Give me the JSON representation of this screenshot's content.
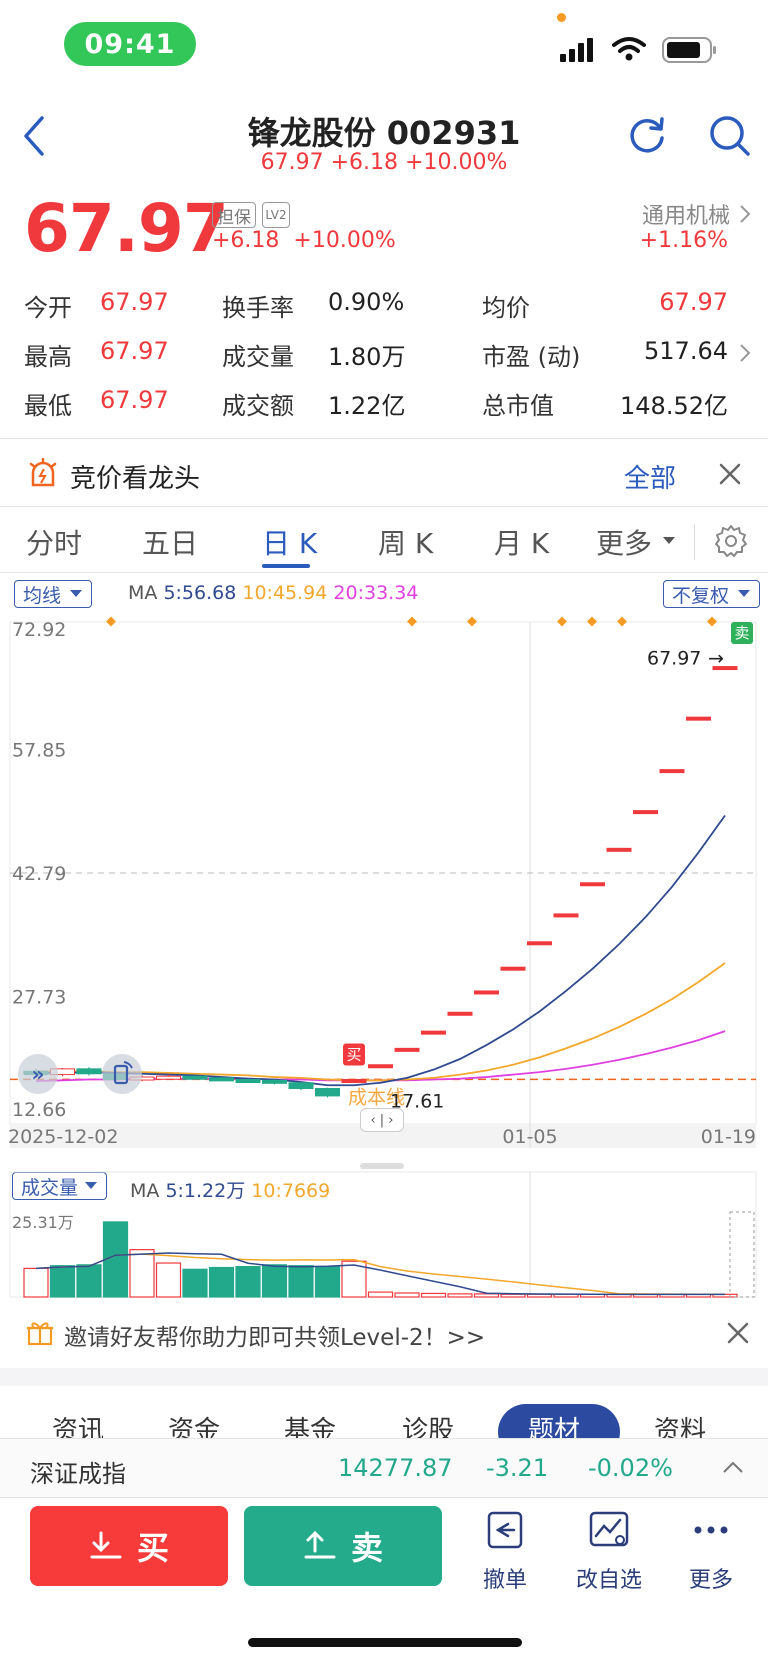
{
  "status": {
    "time": "09:41"
  },
  "header": {
    "title": "锋龙股份 002931",
    "subtitle": "67.97 +6.18 +10.00%"
  },
  "quote": {
    "price": "67.97",
    "tag_margin": "担保",
    "tag_level": "LV2",
    "change": "+6.18",
    "change_pct": "+10.00%",
    "industry": "通用机械",
    "industry_pct": "+1.16%",
    "rows": [
      [
        {
          "label": "今开",
          "value": "67.97"
        },
        {
          "label": "换手率",
          "value": "0.90%"
        },
        {
          "label": "均价",
          "value": "67.97"
        }
      ],
      [
        {
          "label": "最高",
          "value": "67.97"
        },
        {
          "label": "成交量",
          "value": "1.80万"
        },
        {
          "label": "市盈 (动)",
          "value": "517.64"
        }
      ],
      [
        {
          "label": "最低",
          "value": "67.97"
        },
        {
          "label": "成交额",
          "value": "1.22亿"
        },
        {
          "label": "总市值",
          "value": "148.52亿"
        }
      ]
    ]
  },
  "banner": {
    "text": "竞价看龙头",
    "action": "全部"
  },
  "tabs": [
    "分时",
    "五日",
    "日 K",
    "周 K",
    "月 K",
    "更多"
  ],
  "active_tab": 2,
  "kline": {
    "indicator": "均线",
    "ma_prefix": "MA",
    "ma5": "5:56.68",
    "ma10": "10:45.94",
    "ma20": "20:33.34",
    "adjust": "不复权",
    "y_labels": [
      "72.92",
      "57.85",
      "42.79",
      "27.73",
      "12.66"
    ],
    "x_labels": [
      "2025-12-02",
      "01-05",
      "01-19"
    ],
    "last_price_label": "67.97",
    "buy_marker": "买",
    "sell_marker": "卖",
    "cost_label": "成本线",
    "cost_value": "17.61",
    "colors": {
      "ma5": "#2f4a8f",
      "ma10": "#f3a72b",
      "ma20": "#e040e0",
      "up": "#f0393c",
      "down": "#22a88a"
    }
  },
  "volume": {
    "indicator": "成交量",
    "ma_prefix": "MA",
    "ma5": "5:1.22万",
    "ma10": "10:7669",
    "y_max_label": "25.31万"
  },
  "chart_data": {
    "type": "candlestick",
    "ylim": [
      12.66,
      72.92
    ],
    "y_ticks": [
      72.92,
      57.85,
      42.79,
      27.73,
      12.66
    ],
    "x_ticks": [
      "2025-12-02",
      "01-05",
      "01-19"
    ],
    "last_price": 67.97,
    "cost_line": 17.61,
    "candles": [
      {
        "o": 18.6,
        "c": 18.2,
        "h": 18.9,
        "l": 17.9,
        "up": false
      },
      {
        "o": 18.2,
        "c": 18.9,
        "h": 19.0,
        "l": 18.0,
        "up": true
      },
      {
        "o": 18.9,
        "c": 18.3,
        "h": 19.1,
        "l": 18.1,
        "up": false
      },
      {
        "o": 18.3,
        "c": 17.6,
        "h": 18.5,
        "l": 17.4,
        "up": false
      },
      {
        "o": 17.6,
        "c": 17.9,
        "h": 18.1,
        "l": 17.4,
        "up": true
      },
      {
        "o": 17.9,
        "c": 18.0,
        "h": 18.2,
        "l": 17.7,
        "up": true
      },
      {
        "o": 18.0,
        "c": 17.8,
        "h": 18.1,
        "l": 17.6,
        "up": false
      },
      {
        "o": 17.8,
        "c": 17.6,
        "h": 17.9,
        "l": 17.4,
        "up": false
      },
      {
        "o": 17.6,
        "c": 17.5,
        "h": 17.7,
        "l": 17.3,
        "up": false
      },
      {
        "o": 17.5,
        "c": 17.2,
        "h": 17.6,
        "l": 17.0,
        "up": false
      },
      {
        "o": 17.2,
        "c": 16.5,
        "h": 17.3,
        "l": 16.3,
        "up": false
      },
      {
        "o": 16.5,
        "c": 15.6,
        "h": 16.6,
        "l": 15.4,
        "up": false
      },
      {
        "o": 17.6,
        "c": 17.6,
        "h": 17.6,
        "l": 17.6,
        "up": true
      },
      {
        "o": 19.4,
        "c": 19.4,
        "h": 19.4,
        "l": 19.4,
        "up": true
      },
      {
        "o": 21.4,
        "c": 21.4,
        "h": 21.4,
        "l": 21.4,
        "up": true
      },
      {
        "o": 23.5,
        "c": 23.5,
        "h": 23.5,
        "l": 23.5,
        "up": true
      },
      {
        "o": 25.8,
        "c": 25.8,
        "h": 25.8,
        "l": 25.8,
        "up": true
      },
      {
        "o": 28.4,
        "c": 28.4,
        "h": 28.4,
        "l": 28.4,
        "up": true
      },
      {
        "o": 31.3,
        "c": 31.3,
        "h": 31.3,
        "l": 31.3,
        "up": true
      },
      {
        "o": 34.4,
        "c": 34.4,
        "h": 34.4,
        "l": 34.4,
        "up": true
      },
      {
        "o": 37.8,
        "c": 37.8,
        "h": 37.8,
        "l": 37.8,
        "up": true
      },
      {
        "o": 41.6,
        "c": 41.6,
        "h": 41.6,
        "l": 41.6,
        "up": true
      },
      {
        "o": 45.8,
        "c": 45.8,
        "h": 45.8,
        "l": 45.8,
        "up": true
      },
      {
        "o": 50.4,
        "c": 50.4,
        "h": 50.4,
        "l": 50.4,
        "up": true
      },
      {
        "o": 55.4,
        "c": 55.4,
        "h": 55.4,
        "l": 55.4,
        "up": true
      },
      {
        "o": 61.8,
        "c": 61.8,
        "h": 61.8,
        "l": 61.8,
        "up": true
      },
      {
        "o": 67.97,
        "c": 67.97,
        "h": 67.97,
        "l": 67.97,
        "up": true
      }
    ],
    "ma5": [
      18.4,
      18.4,
      18.5,
      18.4,
      18.3,
      18.2,
      18.1,
      17.9,
      17.7,
      17.6,
      17.3,
      16.9,
      16.9,
      17.2,
      17.8,
      18.8,
      20.1,
      21.8,
      23.7,
      25.9,
      28.4,
      31.1,
      34.1,
      37.4,
      41.1,
      45.3,
      49.8
    ],
    "ma10": [
      18.6,
      18.6,
      18.6,
      18.5,
      18.5,
      18.4,
      18.3,
      18.2,
      18.1,
      17.9,
      17.8,
      17.6,
      17.5,
      17.5,
      17.6,
      17.8,
      18.2,
      18.7,
      19.4,
      20.3,
      21.4,
      22.6,
      24.0,
      25.6,
      27.4,
      29.5,
      31.8
    ],
    "ma20": [
      17.4,
      17.5,
      17.6,
      17.6,
      17.7,
      17.7,
      17.7,
      17.7,
      17.7,
      17.6,
      17.6,
      17.5,
      17.5,
      17.5,
      17.5,
      17.6,
      17.7,
      17.9,
      18.2,
      18.5,
      18.9,
      19.4,
      20.0,
      20.7,
      21.5,
      22.4,
      23.5
    ],
    "volume": {
      "ylim": [
        0,
        25.31
      ],
      "unit": "万",
      "bars": [
        {
          "v": 3.2,
          "up": true
        },
        {
          "v": 3.5,
          "up": false
        },
        {
          "v": 3.6,
          "up": false
        },
        {
          "v": 8.4,
          "up": false
        },
        {
          "v": 5.3,
          "up": true
        },
        {
          "v": 3.8,
          "up": true
        },
        {
          "v": 3.1,
          "up": false
        },
        {
          "v": 3.3,
          "up": false
        },
        {
          "v": 3.4,
          "up": false
        },
        {
          "v": 3.6,
          "up": false
        },
        {
          "v": 3.5,
          "up": false
        },
        {
          "v": 3.4,
          "up": false
        },
        {
          "v": 4.0,
          "up": true
        },
        {
          "v": 0.55,
          "up": true
        },
        {
          "v": 0.45,
          "up": true
        },
        {
          "v": 0.4,
          "up": true
        },
        {
          "v": 0.35,
          "up": true
        },
        {
          "v": 0.35,
          "up": true
        },
        {
          "v": 0.3,
          "up": true
        },
        {
          "v": 0.3,
          "up": true
        },
        {
          "v": 0.3,
          "up": true
        },
        {
          "v": 0.3,
          "up": true
        },
        {
          "v": 0.3,
          "up": true
        },
        {
          "v": 0.3,
          "up": true
        },
        {
          "v": 0.3,
          "up": true
        },
        {
          "v": 0.3,
          "up": true
        },
        {
          "v": 0.3,
          "up": true
        }
      ]
    }
  },
  "promo": {
    "text": "邀请好友帮你助力即可共领Level-2！>>"
  },
  "section_tabs": [
    "资讯",
    "资金",
    "基金",
    "诊股",
    "题材",
    "资料"
  ],
  "active_section_tab": 4,
  "index_bar": {
    "name": "深证成指",
    "value": "14277.87",
    "change": "-3.21",
    "pct": "-0.02%"
  },
  "actions": {
    "buy": "买",
    "sell": "卖",
    "cancel": "撤单",
    "watchlist": "改自选",
    "more": "更多"
  }
}
